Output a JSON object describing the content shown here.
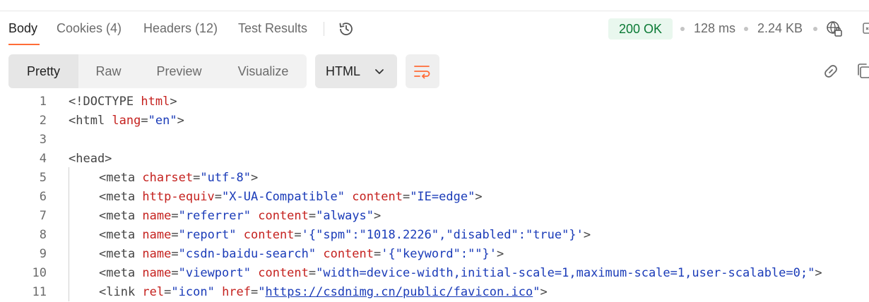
{
  "tabs": [
    {
      "label": "Body"
    },
    {
      "label": "Cookies (4)"
    },
    {
      "label": "Headers (12)"
    },
    {
      "label": "Test Results"
    }
  ],
  "response": {
    "status": "200 OK",
    "time": "128 ms",
    "size": "2.24 KB"
  },
  "view_modes": [
    {
      "label": "Pretty"
    },
    {
      "label": "Raw"
    },
    {
      "label": "Preview"
    },
    {
      "label": "Visualize"
    }
  ],
  "format": {
    "selected": "HTML"
  },
  "icons": {
    "history": "history-icon",
    "globe": "globe-lock-icon",
    "wrap": "wrap-lines-icon",
    "link": "link-icon",
    "copy": "copy-icon",
    "chevron": "chevron-down-icon"
  },
  "colors": {
    "accent": "#ff6c37",
    "status_bg": "#e9f7ee",
    "status_text": "#0b7a35",
    "attr": "#c5221f",
    "string": "#1a3bb8"
  },
  "code_lines": [
    {
      "n": "1",
      "indent": 0,
      "tokens": [
        {
          "t": "<!DOCTYPE ",
          "c": "tag"
        },
        {
          "t": "html",
          "c": "attr"
        },
        {
          "t": ">",
          "c": "tag"
        }
      ]
    },
    {
      "n": "2",
      "indent": 0,
      "tokens": [
        {
          "t": "<html ",
          "c": "tag"
        },
        {
          "t": "lang",
          "c": "attr"
        },
        {
          "t": "=",
          "c": "tag"
        },
        {
          "t": "\"en\"",
          "c": "str"
        },
        {
          "t": ">",
          "c": "tag"
        }
      ]
    },
    {
      "n": "3",
      "indent": 0,
      "tokens": []
    },
    {
      "n": "4",
      "indent": 0,
      "tokens": [
        {
          "t": "<head>",
          "c": "tag"
        }
      ]
    },
    {
      "n": "5",
      "indent": 1,
      "tokens": [
        {
          "t": "<meta ",
          "c": "tag"
        },
        {
          "t": "charset",
          "c": "attr"
        },
        {
          "t": "=",
          "c": "tag"
        },
        {
          "t": "\"utf-8\"",
          "c": "str"
        },
        {
          "t": ">",
          "c": "tag"
        }
      ]
    },
    {
      "n": "6",
      "indent": 1,
      "tokens": [
        {
          "t": "<meta ",
          "c": "tag"
        },
        {
          "t": "http-equiv",
          "c": "attr"
        },
        {
          "t": "=",
          "c": "tag"
        },
        {
          "t": "\"X-UA-Compatible\"",
          "c": "str"
        },
        {
          "t": " ",
          "c": "tag"
        },
        {
          "t": "content",
          "c": "attr"
        },
        {
          "t": "=",
          "c": "tag"
        },
        {
          "t": "\"IE=edge\"",
          "c": "str"
        },
        {
          "t": ">",
          "c": "tag"
        }
      ]
    },
    {
      "n": "7",
      "indent": 1,
      "tokens": [
        {
          "t": "<meta ",
          "c": "tag"
        },
        {
          "t": "name",
          "c": "attr"
        },
        {
          "t": "=",
          "c": "tag"
        },
        {
          "t": "\"referrer\"",
          "c": "str"
        },
        {
          "t": " ",
          "c": "tag"
        },
        {
          "t": "content",
          "c": "attr"
        },
        {
          "t": "=",
          "c": "tag"
        },
        {
          "t": "\"always\"",
          "c": "str"
        },
        {
          "t": ">",
          "c": "tag"
        }
      ]
    },
    {
      "n": "8",
      "indent": 1,
      "tokens": [
        {
          "t": "<meta ",
          "c": "tag"
        },
        {
          "t": "name",
          "c": "attr"
        },
        {
          "t": "=",
          "c": "tag"
        },
        {
          "t": "\"report\"",
          "c": "str"
        },
        {
          "t": " ",
          "c": "tag"
        },
        {
          "t": "content",
          "c": "attr"
        },
        {
          "t": "=",
          "c": "tag"
        },
        {
          "t": "'{\"spm\":\"1018.2226\",\"disabled\":\"true\"}'",
          "c": "str"
        },
        {
          "t": ">",
          "c": "tag"
        }
      ]
    },
    {
      "n": "9",
      "indent": 1,
      "tokens": [
        {
          "t": "<meta ",
          "c": "tag"
        },
        {
          "t": "name",
          "c": "attr"
        },
        {
          "t": "=",
          "c": "tag"
        },
        {
          "t": "\"csdn-baidu-search\"",
          "c": "str"
        },
        {
          "t": " ",
          "c": "tag"
        },
        {
          "t": "content",
          "c": "attr"
        },
        {
          "t": "=",
          "c": "tag"
        },
        {
          "t": "'{\"keyword\":\"\"}'",
          "c": "str"
        },
        {
          "t": ">",
          "c": "tag"
        }
      ]
    },
    {
      "n": "10",
      "indent": 1,
      "tokens": [
        {
          "t": "<meta ",
          "c": "tag"
        },
        {
          "t": "name",
          "c": "attr"
        },
        {
          "t": "=",
          "c": "tag"
        },
        {
          "t": "\"viewport\"",
          "c": "str"
        },
        {
          "t": " ",
          "c": "tag"
        },
        {
          "t": "content",
          "c": "attr"
        },
        {
          "t": "=",
          "c": "tag"
        },
        {
          "t": "\"width=device-width,initial-scale=1,maximum-scale=1,user-scalable=0;\"",
          "c": "str"
        },
        {
          "t": ">",
          "c": "tag"
        }
      ]
    },
    {
      "n": "11",
      "indent": 1,
      "tokens": [
        {
          "t": "<link ",
          "c": "tag"
        },
        {
          "t": "rel",
          "c": "attr"
        },
        {
          "t": "=",
          "c": "tag"
        },
        {
          "t": "\"icon\"",
          "c": "str"
        },
        {
          "t": " ",
          "c": "tag"
        },
        {
          "t": "href",
          "c": "attr"
        },
        {
          "t": "=",
          "c": "tag"
        },
        {
          "t": "\"",
          "c": "str"
        },
        {
          "t": "https://csdnimg.cn/public/favicon.ico",
          "c": "url"
        },
        {
          "t": "\"",
          "c": "str"
        },
        {
          "t": ">",
          "c": "tag"
        }
      ]
    }
  ]
}
